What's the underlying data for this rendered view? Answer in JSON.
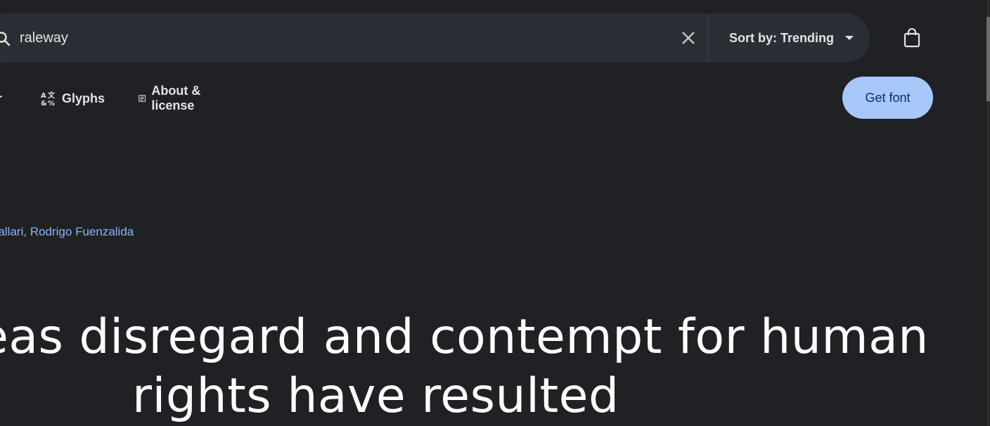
{
  "search": {
    "value": "raleway",
    "placeholder": ""
  },
  "sort": {
    "label": "Sort by: Trending"
  },
  "tabs": {
    "partial_label": "r",
    "glyphs_label": "Glyphs",
    "about_label": "About & license"
  },
  "get_font_label": "Get font",
  "designers": {
    "partial": "pallari",
    "separator": ", ",
    "second": "Rodrigo Fuenzalida"
  },
  "sample": {
    "line1": "eas disregard and contempt for human",
    "line2": "rights have resulted"
  },
  "colors": {
    "background": "#202124",
    "search_bg": "#2a2e35",
    "accent_button": "#a8c7fa",
    "link": "#8ab4f8"
  },
  "icons": [
    "search-icon",
    "close-icon",
    "chevron-down-icon",
    "shopping-bag-icon",
    "glyphs-icon",
    "article-icon"
  ]
}
